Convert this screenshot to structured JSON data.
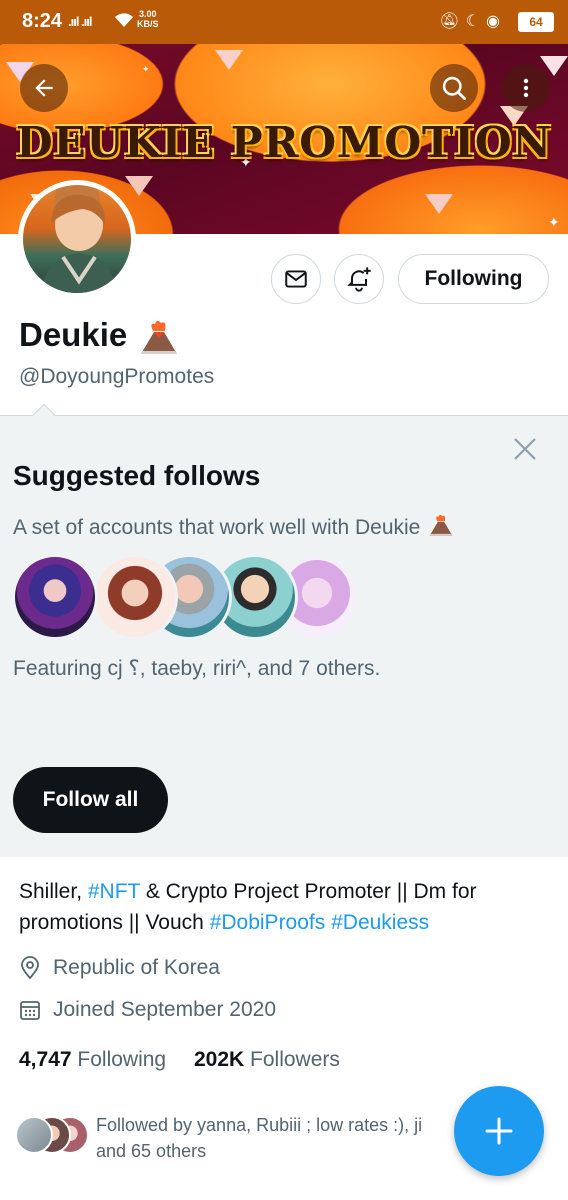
{
  "status_bar": {
    "time": "8:24",
    "signal": ".ııl .ııl",
    "speed_value": "3.00",
    "speed_unit": "KB/S",
    "battery": "64"
  },
  "banner": {
    "title": "DEUKIE PROMOTION"
  },
  "header_actions": {
    "back_icon": "arrow-left-icon",
    "search_icon": "search-icon",
    "more_icon": "more-vertical-icon"
  },
  "profile": {
    "display_name": "Deukie",
    "name_emoji": "volcano",
    "handle": "@DoyoungPromotes",
    "following_button": "Following",
    "message_icon": "mail-icon",
    "notify_icon": "bell-plus-icon"
  },
  "suggested": {
    "title": "Suggested follows",
    "description": "A set of accounts that work well with Deukie",
    "featuring": "Featuring cj ⸮, taeby, riri^, and 7 others.",
    "follow_all": "Follow all",
    "close_icon": "close-icon"
  },
  "bio": {
    "part1": "Shiller, ",
    "tag1": "#NFT",
    "part2": " & Crypto Project Promoter || Dm for promotions || Vouch ",
    "tag2": "#DobiProofs",
    "part3": " ",
    "tag3": "#Deukiess"
  },
  "meta": {
    "location": "Republic of Korea",
    "joined": "Joined September 2020"
  },
  "stats": {
    "following_count": "4,747",
    "following_label": "Following",
    "followers_count": "202K",
    "followers_label": "Followers"
  },
  "followed_by": {
    "line1": "Followed by yanna, Rubiii ; low rates :), ji",
    "line2": "and 65 others"
  },
  "fab": {
    "icon": "plus-icon"
  },
  "colors": {
    "accent": "#1d9bf0",
    "status_bar": "#b85a07",
    "panel_bg": "#eff3f4",
    "muted_text": "#536471"
  }
}
